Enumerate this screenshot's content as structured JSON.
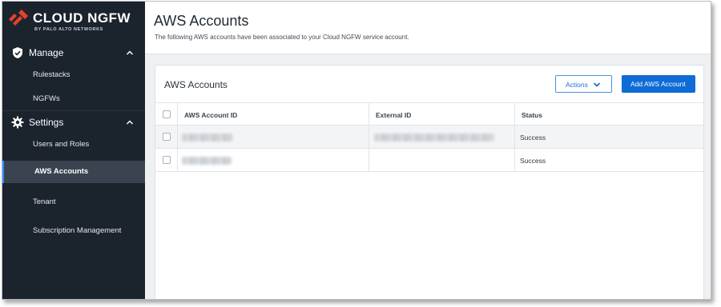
{
  "brand": {
    "name": "CLOUD NGFW",
    "subtitle": "BY PALO ALTO NETWORKS",
    "logo_icon": "palo-alto-logo",
    "accent_color": "#e5412a"
  },
  "sidebar": {
    "sections": [
      {
        "label": "Manage",
        "icon": "shield-check-icon",
        "expanded": true,
        "items": [
          {
            "label": "Rulestacks"
          },
          {
            "label": "NGFWs"
          }
        ]
      },
      {
        "label": "Settings",
        "icon": "gear-icon",
        "expanded": true,
        "items": [
          {
            "label": "Users and Roles"
          },
          {
            "label": "AWS Accounts",
            "active": true
          },
          {
            "label": "Tenant"
          },
          {
            "label": "Subscription Management"
          }
        ]
      }
    ],
    "background_color": "#1b232d",
    "active_accent_color": "#2f8cff"
  },
  "header": {
    "title": "AWS Accounts",
    "description": "The following AWS accounts have been associated to your Cloud NGFW service account."
  },
  "card": {
    "title": "AWS Accounts",
    "actions_label": "Actions",
    "add_label": "Add AWS Account",
    "primary_color": "#0f6bd6"
  },
  "table": {
    "columns": [
      "AWS Account ID",
      "External ID",
      "Status"
    ],
    "rows": [
      {
        "account_id_redacted": true,
        "external_id_redacted": true,
        "status": "Success"
      },
      {
        "account_id_redacted": true,
        "external_id_redacted": false,
        "status": "Success"
      }
    ]
  }
}
